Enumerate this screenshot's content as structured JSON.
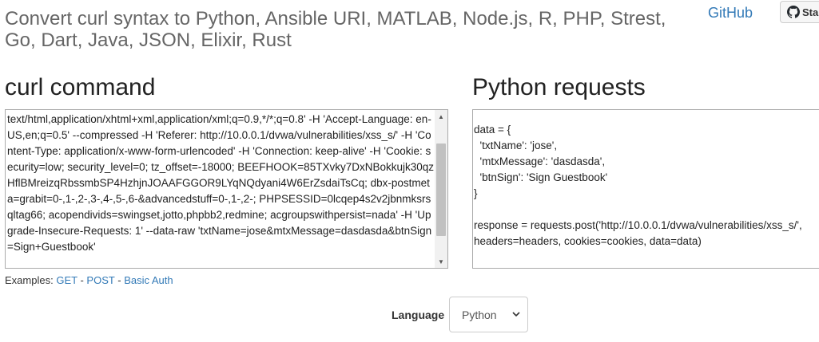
{
  "header": {
    "headline": "Convert curl syntax to Python, Ansible URI, MATLAB, Node.js, R, PHP, Strest, Go, Dart, Java, JSON, Elixir, Rust",
    "github_link": "GitHub",
    "github_button": "Star"
  },
  "curl_section": {
    "title": "curl command",
    "value": "text/html,application/xhtml+xml,application/xml;q=0.9,*/*;q=0.8' -H 'Accept-Language: en-US,en;q=0.5' --compressed -H 'Referer: http://10.0.0.1/dvwa/vulnerabilities/xss_s/' -H 'Content-Type: application/x-www-form-urlencoded' -H 'Connection: keep-alive' -H 'Cookie: security=low; security_level=0; tz_offset=-18000; BEEFHOOK=85TXvky7DxNBokkujk30qzHflBMreizqRbssmbSP4HzhjnJOAAFGGOR9LYqNQdyani4W6ErZsdaiTsCq; dbx-postmeta=grabit=0-,1-,2-,3-,4-,5-,6-&advancedstuff=0-,1-,2-; PHPSESSID=0lcqep4s2v2jbnmksrsqltag66; acopendivids=swingset,jotto,phpbb2,redmine; acgroupswithpersist=nada' -H 'Upgrade-Insecure-Requests: 1' --data-raw 'txtName=jose&mtxMessage=dasdasda&btnSign=Sign+Guestbook'"
  },
  "python_section": {
    "title": "Python requests",
    "code": "data = {\n  'txtName': 'jose',\n  'mtxMessage': 'dasdasda',\n  'btnSign': 'Sign Guestbook'\n}\n\nresponse = requests.post('http://10.0.0.1/dvwa/vulnerabilities/xss_s/',\nheaders=headers, cookies=cookies, data=data)"
  },
  "examples": {
    "label": "Examples:",
    "links": [
      "GET",
      "POST",
      "Basic Auth"
    ],
    "separator": "-"
  },
  "language": {
    "label": "Language",
    "selected": "Python"
  },
  "icons": {
    "github": "github-icon",
    "scroll_up": "scroll-up-arrow-icon",
    "scroll_down": "scroll-down-arrow-icon",
    "select": "chevron-down-icon"
  },
  "colors": {
    "link": "#337ab7",
    "headline": "#666666"
  }
}
